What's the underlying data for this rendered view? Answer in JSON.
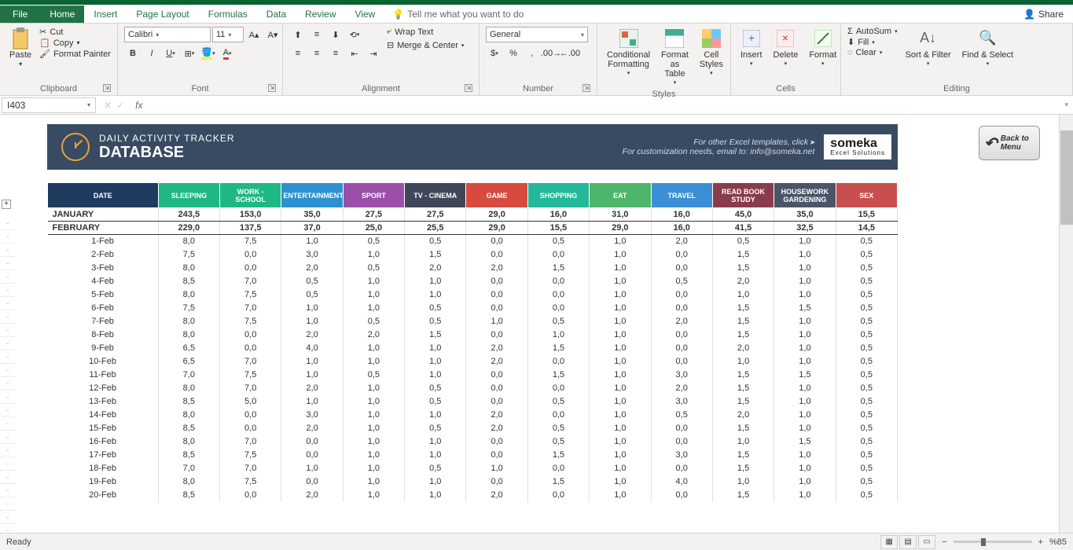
{
  "app": {
    "tabs": [
      "File",
      "Home",
      "Insert",
      "Page Layout",
      "Formulas",
      "Data",
      "Review",
      "View"
    ],
    "active_tab": "Home",
    "tell_me": "Tell me what you want to do",
    "share": "Share"
  },
  "ribbon": {
    "clipboard": {
      "label": "Clipboard",
      "paste": "Paste",
      "cut": "Cut",
      "copy": "Copy",
      "format_painter": "Format Painter"
    },
    "font": {
      "label": "Font",
      "name": "Calibri",
      "size": "11"
    },
    "alignment": {
      "label": "Alignment",
      "wrap": "Wrap Text",
      "merge": "Merge & Center"
    },
    "number": {
      "label": "Number",
      "format": "General"
    },
    "styles": {
      "label": "Styles",
      "conditional": "Conditional Formatting",
      "format_table": "Format as Table",
      "cell_styles": "Cell Styles"
    },
    "cells": {
      "label": "Cells",
      "insert": "Insert",
      "delete": "Delete",
      "format": "Format"
    },
    "editing": {
      "label": "Editing",
      "autosum": "AutoSum",
      "fill": "Fill",
      "clear": "Clear",
      "sort": "Sort & Filter",
      "find": "Find & Select"
    }
  },
  "formula_bar": {
    "name_box": "I403",
    "fx": "fx"
  },
  "doc": {
    "title1": "DAILY ACTIVITY TRACKER",
    "title2": "DATABASE",
    "promo1": "For other Excel templates, click ▸",
    "promo2": "For customization needs, email to: info@someka.net",
    "logo": "someka",
    "logo_sub": "Excel Solutions",
    "back": "Back to Menu"
  },
  "columns": [
    {
      "label": "DATE",
      "bg": "#1f3a5f"
    },
    {
      "label": "SLEEPING",
      "bg": "#1fb885"
    },
    {
      "label": "WORK - SCHOOL",
      "bg": "#1fb885"
    },
    {
      "label": "ENTERTAINMENT",
      "bg": "#2e91cf"
    },
    {
      "label": "SPORT",
      "bg": "#9b4fa8"
    },
    {
      "label": "TV - CINEMA",
      "bg": "#3d4758"
    },
    {
      "label": "GAME",
      "bg": "#d64a3f"
    },
    {
      "label": "SHOPPING",
      "bg": "#24b89a"
    },
    {
      "label": "EAT",
      "bg": "#4fb56b"
    },
    {
      "label": "TRAVEL",
      "bg": "#3b8fd4"
    },
    {
      "label": "READ BOOK STUDY",
      "bg": "#8a3c4a"
    },
    {
      "label": "HOUSEWORK GARDENING",
      "bg": "#4a5568"
    },
    {
      "label": "SEX",
      "bg": "#c94f4f"
    }
  ],
  "summary_rows": [
    {
      "label": "JANUARY",
      "vals": [
        "243,5",
        "153,0",
        "35,0",
        "27,5",
        "27,5",
        "29,0",
        "16,0",
        "31,0",
        "16,0",
        "45,0",
        "35,0",
        "15,5"
      ]
    },
    {
      "label": "FEBRUARY",
      "vals": [
        "229,0",
        "137,5",
        "37,0",
        "25,0",
        "25,5",
        "29,0",
        "15,5",
        "29,0",
        "16,0",
        "41,5",
        "32,5",
        "14,5"
      ]
    }
  ],
  "data_rows": [
    {
      "d": "1-Feb",
      "v": [
        "8,0",
        "7,5",
        "1,0",
        "0,5",
        "0,5",
        "0,0",
        "0,5",
        "1,0",
        "2,0",
        "0,5",
        "1,0",
        "0,5"
      ]
    },
    {
      "d": "2-Feb",
      "v": [
        "7,5",
        "0,0",
        "3,0",
        "1,0",
        "1,5",
        "0,0",
        "0,0",
        "1,0",
        "0,0",
        "1,5",
        "1,0",
        "0,5"
      ]
    },
    {
      "d": "3-Feb",
      "v": [
        "8,0",
        "0,0",
        "2,0",
        "0,5",
        "2,0",
        "2,0",
        "1,5",
        "1,0",
        "0,0",
        "1,5",
        "1,0",
        "0,5"
      ]
    },
    {
      "d": "4-Feb",
      "v": [
        "8,5",
        "7,0",
        "0,5",
        "1,0",
        "1,0",
        "0,0",
        "0,0",
        "1,0",
        "0,5",
        "2,0",
        "1,0",
        "0,5"
      ]
    },
    {
      "d": "5-Feb",
      "v": [
        "8,0",
        "7,5",
        "0,5",
        "1,0",
        "1,0",
        "0,0",
        "0,0",
        "1,0",
        "0,0",
        "1,0",
        "1,0",
        "0,5"
      ]
    },
    {
      "d": "6-Feb",
      "v": [
        "7,5",
        "7,0",
        "1,0",
        "1,0",
        "0,5",
        "0,0",
        "0,0",
        "1,0",
        "0,0",
        "1,5",
        "1,5",
        "0,5"
      ]
    },
    {
      "d": "7-Feb",
      "v": [
        "8,0",
        "7,5",
        "1,0",
        "0,5",
        "0,5",
        "1,0",
        "0,5",
        "1,0",
        "2,0",
        "1,5",
        "1,0",
        "0,5"
      ]
    },
    {
      "d": "8-Feb",
      "v": [
        "8,0",
        "0,0",
        "2,0",
        "2,0",
        "1,5",
        "0,0",
        "1,0",
        "1,0",
        "0,0",
        "1,5",
        "1,0",
        "0,5"
      ]
    },
    {
      "d": "9-Feb",
      "v": [
        "6,5",
        "0,0",
        "4,0",
        "1,0",
        "1,0",
        "2,0",
        "1,5",
        "1,0",
        "0,0",
        "2,0",
        "1,0",
        "0,5"
      ]
    },
    {
      "d": "10-Feb",
      "v": [
        "6,5",
        "7,0",
        "1,0",
        "1,0",
        "1,0",
        "2,0",
        "0,0",
        "1,0",
        "0,0",
        "1,0",
        "1,0",
        "0,5"
      ]
    },
    {
      "d": "11-Feb",
      "v": [
        "7,0",
        "7,5",
        "1,0",
        "0,5",
        "1,0",
        "0,0",
        "1,5",
        "1,0",
        "3,0",
        "1,5",
        "1,5",
        "0,5"
      ]
    },
    {
      "d": "12-Feb",
      "v": [
        "8,0",
        "7,0",
        "2,0",
        "1,0",
        "0,5",
        "0,0",
        "0,0",
        "1,0",
        "2,0",
        "1,5",
        "1,0",
        "0,5"
      ]
    },
    {
      "d": "13-Feb",
      "v": [
        "8,5",
        "5,0",
        "1,0",
        "1,0",
        "0,5",
        "0,0",
        "0,5",
        "1,0",
        "3,0",
        "1,5",
        "1,0",
        "0,5"
      ]
    },
    {
      "d": "14-Feb",
      "v": [
        "8,0",
        "0,0",
        "3,0",
        "1,0",
        "1,0",
        "2,0",
        "0,0",
        "1,0",
        "0,5",
        "2,0",
        "1,0",
        "0,5"
      ]
    },
    {
      "d": "15-Feb",
      "v": [
        "8,5",
        "0,0",
        "2,0",
        "1,0",
        "0,5",
        "2,0",
        "0,5",
        "1,0",
        "0,0",
        "1,5",
        "1,0",
        "0,5"
      ]
    },
    {
      "d": "16-Feb",
      "v": [
        "8,0",
        "7,0",
        "0,0",
        "1,0",
        "1,0",
        "0,0",
        "0,5",
        "1,0",
        "0,0",
        "1,0",
        "1,5",
        "0,5"
      ]
    },
    {
      "d": "17-Feb",
      "v": [
        "8,5",
        "7,5",
        "0,0",
        "1,0",
        "1,0",
        "0,0",
        "1,5",
        "1,0",
        "3,0",
        "1,5",
        "1,0",
        "0,5"
      ]
    },
    {
      "d": "18-Feb",
      "v": [
        "7,0",
        "7,0",
        "1,0",
        "1,0",
        "0,5",
        "1,0",
        "0,0",
        "1,0",
        "0,0",
        "1,5",
        "1,0",
        "0,5"
      ]
    },
    {
      "d": "19-Feb",
      "v": [
        "8,0",
        "7,5",
        "0,0",
        "1,0",
        "1,0",
        "0,0",
        "1,5",
        "1,0",
        "4,0",
        "1,0",
        "1,0",
        "0,5"
      ]
    },
    {
      "d": "20-Feb",
      "v": [
        "8,5",
        "0,0",
        "2,0",
        "1,0",
        "1,0",
        "2,0",
        "0,0",
        "1,0",
        "0,0",
        "1,5",
        "1,0",
        "0,5"
      ]
    }
  ],
  "status": {
    "ready": "Ready",
    "zoom": "%85"
  },
  "chart_data": {
    "type": "table",
    "columns": [
      "DATE",
      "SLEEPING",
      "WORK - SCHOOL",
      "ENTERTAINMENT",
      "SPORT",
      "TV - CINEMA",
      "GAME",
      "SHOPPING",
      "EAT",
      "TRAVEL",
      "READ BOOK STUDY",
      "HOUSEWORK GARDENING",
      "SEX"
    ],
    "summary": {
      "JANUARY": [
        243.5,
        153.0,
        35.0,
        27.5,
        27.5,
        29.0,
        16.0,
        31.0,
        16.0,
        45.0,
        35.0,
        15.5
      ],
      "FEBRUARY": [
        229.0,
        137.5,
        37.0,
        25.0,
        25.5,
        29.0,
        15.5,
        29.0,
        16.0,
        41.5,
        32.5,
        14.5
      ]
    },
    "rows": [
      [
        "1-Feb",
        8.0,
        7.5,
        1.0,
        0.5,
        0.5,
        0.0,
        0.5,
        1.0,
        2.0,
        0.5,
        1.0,
        0.5
      ],
      [
        "2-Feb",
        7.5,
        0.0,
        3.0,
        1.0,
        1.5,
        0.0,
        0.0,
        1.0,
        0.0,
        1.5,
        1.0,
        0.5
      ],
      [
        "3-Feb",
        8.0,
        0.0,
        2.0,
        0.5,
        2.0,
        2.0,
        1.5,
        1.0,
        0.0,
        1.5,
        1.0,
        0.5
      ],
      [
        "4-Feb",
        8.5,
        7.0,
        0.5,
        1.0,
        1.0,
        0.0,
        0.0,
        1.0,
        0.5,
        2.0,
        1.0,
        0.5
      ],
      [
        "5-Feb",
        8.0,
        7.5,
        0.5,
        1.0,
        1.0,
        0.0,
        0.0,
        1.0,
        0.0,
        1.0,
        1.0,
        0.5
      ],
      [
        "6-Feb",
        7.5,
        7.0,
        1.0,
        1.0,
        0.5,
        0.0,
        0.0,
        1.0,
        0.0,
        1.5,
        1.5,
        0.5
      ],
      [
        "7-Feb",
        8.0,
        7.5,
        1.0,
        0.5,
        0.5,
        1.0,
        0.5,
        1.0,
        2.0,
        1.5,
        1.0,
        0.5
      ],
      [
        "8-Feb",
        8.0,
        0.0,
        2.0,
        2.0,
        1.5,
        0.0,
        1.0,
        1.0,
        0.0,
        1.5,
        1.0,
        0.5
      ],
      [
        "9-Feb",
        6.5,
        0.0,
        4.0,
        1.0,
        1.0,
        2.0,
        1.5,
        1.0,
        0.0,
        2.0,
        1.0,
        0.5
      ],
      [
        "10-Feb",
        6.5,
        7.0,
        1.0,
        1.0,
        1.0,
        2.0,
        0.0,
        1.0,
        0.0,
        1.0,
        1.0,
        0.5
      ],
      [
        "11-Feb",
        7.0,
        7.5,
        1.0,
        0.5,
        1.0,
        0.0,
        1.5,
        1.0,
        3.0,
        1.5,
        1.5,
        0.5
      ],
      [
        "12-Feb",
        8.0,
        7.0,
        2.0,
        1.0,
        0.5,
        0.0,
        0.0,
        1.0,
        2.0,
        1.5,
        1.0,
        0.5
      ],
      [
        "13-Feb",
        8.5,
        5.0,
        1.0,
        1.0,
        0.5,
        0.0,
        0.5,
        1.0,
        3.0,
        1.5,
        1.0,
        0.5
      ],
      [
        "14-Feb",
        8.0,
        0.0,
        3.0,
        1.0,
        1.0,
        2.0,
        0.0,
        1.0,
        0.5,
        2.0,
        1.0,
        0.5
      ],
      [
        "15-Feb",
        8.5,
        0.0,
        2.0,
        1.0,
        0.5,
        2.0,
        0.5,
        1.0,
        0.0,
        1.5,
        1.0,
        0.5
      ],
      [
        "16-Feb",
        8.0,
        7.0,
        0.0,
        1.0,
        1.0,
        0.0,
        0.5,
        1.0,
        0.0,
        1.0,
        1.5,
        0.5
      ],
      [
        "17-Feb",
        8.5,
        7.5,
        0.0,
        1.0,
        1.0,
        0.0,
        1.5,
        1.0,
        3.0,
        1.5,
        1.0,
        0.5
      ],
      [
        "18-Feb",
        7.0,
        7.0,
        1.0,
        1.0,
        0.5,
        1.0,
        0.0,
        1.0,
        0.0,
        1.5,
        1.0,
        0.5
      ],
      [
        "19-Feb",
        8.0,
        7.5,
        0.0,
        1.0,
        1.0,
        0.0,
        1.5,
        1.0,
        4.0,
        1.0,
        1.0,
        0.5
      ],
      [
        "20-Feb",
        8.5,
        0.0,
        2.0,
        1.0,
        1.0,
        2.0,
        0.0,
        1.0,
        0.0,
        1.5,
        1.0,
        0.5
      ]
    ]
  }
}
